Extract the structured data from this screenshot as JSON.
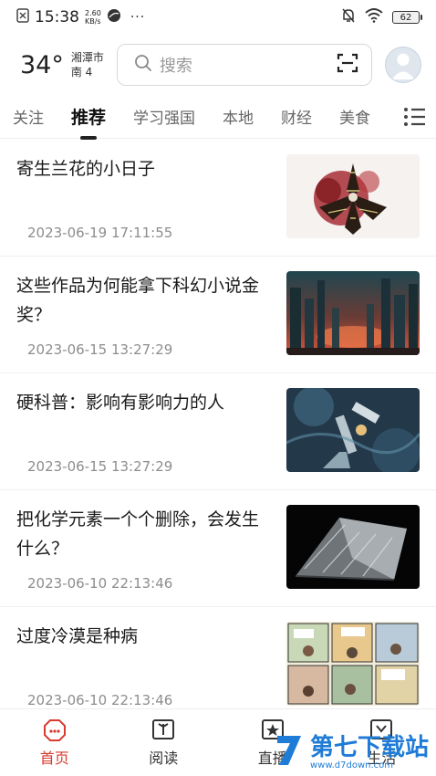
{
  "status_bar": {
    "time": "15:38",
    "net_speed_value": "2.60",
    "net_speed_unit": "KB/s",
    "more": "···",
    "battery": "62"
  },
  "header": {
    "temperature": "34°",
    "city": "湘潭市",
    "wind": "南 4",
    "search_placeholder": "搜索"
  },
  "tabs": [
    "关注",
    "推荐",
    "学习强国",
    "本地",
    "财经",
    "美食"
  ],
  "active_tab": "推荐",
  "feed": [
    {
      "title": "寄生兰花的小日子",
      "time": "2023-06-19 17:11:55"
    },
    {
      "title": "这些作品为何能拿下科幻小说金奖？",
      "time": "2023-06-15 13:27:29"
    },
    {
      "title": "硬科普：影响有影响力的人",
      "time": "2023-06-15 13:27:29"
    },
    {
      "title": "把化学元素一个个删除，会发生什么？",
      "time": "2023-06-10 22:13:46"
    },
    {
      "title": "过度冷漠是种病",
      "time": "2023-06-10 22:13:46"
    }
  ],
  "bottom_nav": [
    {
      "label": "首页"
    },
    {
      "label": "阅读"
    },
    {
      "label": "直播"
    },
    {
      "label": "生活"
    }
  ],
  "watermark": {
    "text": "第七下载站",
    "sub": "www.d7down.com"
  },
  "colors": {
    "accent": "#d83a2e",
    "watermark": "#1e7bd6"
  }
}
